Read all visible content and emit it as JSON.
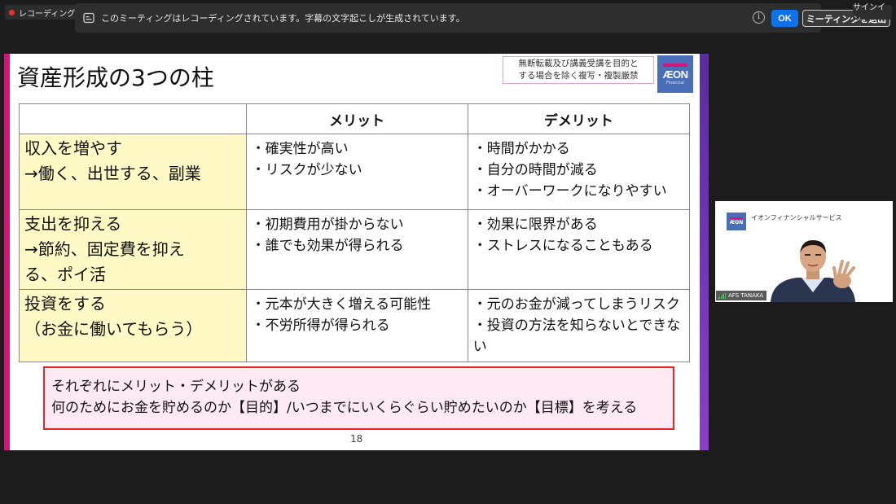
{
  "recording_badge": {
    "label": "レコーディング"
  },
  "notification": {
    "message": "このミーティングはレコーディングされています。字幕の文字起こしが生成されています。",
    "info_icon": "i",
    "ok_label": "OK",
    "leave_label": "ミーティングを退出"
  },
  "signin_label": "サインイン",
  "slide": {
    "title": "資産形成の3つの柱",
    "copyright_note": [
      "無断転載及び講義受講を目的と",
      "する場合を除く複写・複製厳禁"
    ],
    "logo": {
      "wordmark": "ÆON",
      "sub": "Financial"
    },
    "table": {
      "headers": [
        "",
        "メリット",
        "デメリット"
      ],
      "rows": [
        {
          "topic": [
            "収入を増やす",
            "→働く、出世する、副業"
          ],
          "merits": [
            "・確実性が高い",
            "・リスクが少ない"
          ],
          "demerits": [
            "・時間がかかる",
            "・自分の時間が減る",
            "・オーバーワークになりやすい"
          ]
        },
        {
          "topic": [
            "支出を抑える",
            "→節約、固定費を抑え",
            "る、ポイ活"
          ],
          "merits": [
            "・初期費用が掛からない",
            "・誰でも効果が得られる"
          ],
          "demerits": [
            "・効果に限界がある",
            "・ストレスになることもある"
          ]
        },
        {
          "topic": [
            "投資をする",
            "（お金に働いてもらう）"
          ],
          "merits": [
            "・元本が大きく増える可能性",
            "・不労所得が得られる"
          ],
          "demerits": [
            "・元のお金が減ってしまうリスク",
            "・投資の方法を知らないとできない"
          ]
        }
      ]
    },
    "summary": [
      "それぞれにメリット・デメリットがある",
      "何のためにお金を貯めるのか【目的】/いつまでにいくらぐらい貯めたいのか【目標】を考える"
    ],
    "page_number": "18"
  },
  "video": {
    "company": "イオンフィナンシャルサービス",
    "logo_text": "ÆON",
    "participant_name": "AFS TANAKA"
  },
  "colors": {
    "slide_left_bar": "#d4147a",
    "slide_right_bar": "#6a33b0",
    "topic_cell_bg": "#fff9c6",
    "summary_bg": "#fde9f4",
    "summary_border": "#e32525",
    "ok_button": "#0e72ed"
  }
}
